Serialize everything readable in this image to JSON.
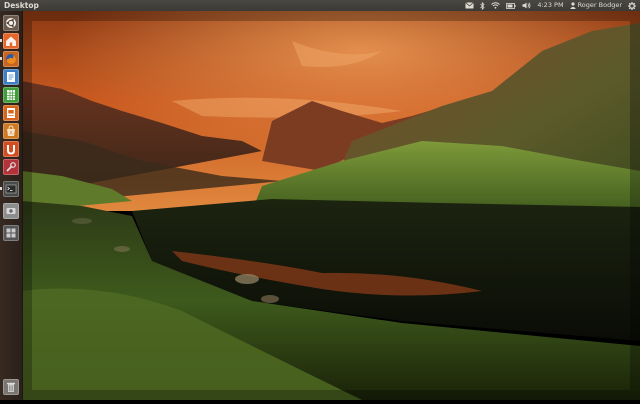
{
  "panel": {
    "title": "Desktop",
    "clock": "4:23 PM",
    "user_name": "Roger Bodger",
    "indicators": [
      "mail-icon",
      "bluetooth-icon",
      "network-icon",
      "battery-icon",
      "volume-icon",
      "user-icon",
      "gear-icon"
    ]
  },
  "launcher": {
    "items": [
      {
        "name": "dash-home",
        "icon": "ubuntu-logo-icon",
        "color": "#6a5a4e"
      },
      {
        "name": "home-folder",
        "icon": "folder-home-icon",
        "color": "#e4662b"
      },
      {
        "name": "firefox",
        "icon": "firefox-icon",
        "color": "#c8661f"
      },
      {
        "name": "libreoffice-writer",
        "icon": "writer-document-icon",
        "color": "#3f7fc4"
      },
      {
        "name": "libreoffice-calc",
        "icon": "calc-spreadsheet-icon",
        "color": "#3f9e3a"
      },
      {
        "name": "libreoffice-impress",
        "icon": "impress-presentation-icon",
        "color": "#d5661e"
      },
      {
        "name": "ubuntu-software-center",
        "icon": "software-center-icon",
        "color": "#cf7a22"
      },
      {
        "name": "ubuntu-one",
        "icon": "ubuntu-one-icon",
        "color": "#d24d1f"
      },
      {
        "name": "system-settings",
        "icon": "settings-icon",
        "color": "#b3333a"
      },
      {
        "name": "terminal",
        "icon": "terminal-icon",
        "color": "#4a4a4a"
      },
      {
        "name": "disk-drive",
        "icon": "disk-icon",
        "color": "#8d8d8d"
      },
      {
        "name": "workspace-switcher",
        "icon": "workspace-icon",
        "color": "#555555"
      },
      {
        "name": "trash",
        "icon": "trash-icon",
        "color": "#7a7570"
      }
    ]
  }
}
